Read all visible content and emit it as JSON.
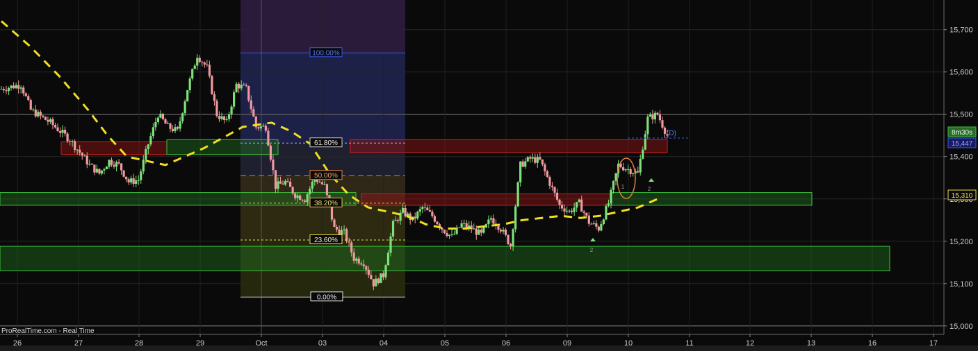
{
  "watermark": "ProRealTime.com - Real Time",
  "colors": {
    "background": "#0a0a0a",
    "up": "#7ee07a",
    "down": "#f09aa0",
    "ma": "#f0e020",
    "support_zone": "#1f6a1f",
    "resistance_zone": "#8a1a1a"
  },
  "chart_data": {
    "type": "candlestick",
    "ylim": [
      14980,
      15770
    ],
    "yticks": [
      15000,
      15100,
      15200,
      15300,
      15400,
      15500,
      15600,
      15700
    ],
    "ytick_labels": [
      "15,000",
      "15,100",
      "15,200",
      "15,300",
      "15,400",
      "15,500",
      "15,600",
      "15,700"
    ],
    "xtick_labels": [
      "26",
      "27",
      "28",
      "29",
      "Oct",
      "03",
      "04",
      "05",
      "06",
      "09",
      "10",
      "11",
      "12",
      "13",
      "16",
      "17"
    ],
    "price_labels": {
      "timer": "8m30s",
      "last": "15,447",
      "marker": "15,310"
    },
    "fib_labels": [
      "100.00%",
      "61.80%",
      "50.00%",
      "38.20%",
      "23.60%",
      "0.00%"
    ],
    "fib_levels": [
      {
        "label": "100.00%",
        "price": 15645
      },
      {
        "label": "61.80%",
        "price": 15432
      },
      {
        "label": "50.00%",
        "price": 15355
      },
      {
        "label": "38.20%",
        "price": 15290
      },
      {
        "label": "23.60%",
        "price": 15203
      },
      {
        "label": "0.00%",
        "price": 15068
      }
    ],
    "annotations": [
      "2",
      "2",
      "1",
      "(D)"
    ],
    "close_path": [
      [
        0,
        15560
      ],
      [
        2,
        15570
      ],
      [
        3,
        15510
      ],
      [
        5,
        15480
      ],
      [
        7,
        15440
      ],
      [
        9,
        15380
      ],
      [
        10,
        15360
      ],
      [
        11,
        15390
      ],
      [
        12,
        15380
      ],
      [
        13,
        15340
      ],
      [
        14,
        15345
      ],
      [
        15,
        15430
      ],
      [
        16,
        15500
      ],
      [
        17,
        15470
      ],
      [
        18,
        15460
      ],
      [
        19,
        15560
      ],
      [
        20,
        15640
      ],
      [
        21,
        15610
      ],
      [
        22,
        15500
      ],
      [
        23,
        15480
      ],
      [
        24,
        15570
      ],
      [
        25,
        15560
      ],
      [
        26,
        15470
      ],
      [
        27,
        15470
      ],
      [
        28,
        15330
      ],
      [
        29,
        15340
      ],
      [
        30,
        15310
      ],
      [
        31,
        15300
      ],
      [
        32,
        15350
      ],
      [
        33,
        15330
      ],
      [
        34,
        15230
      ],
      [
        35,
        15220
      ],
      [
        36,
        15160
      ],
      [
        37,
        15150
      ],
      [
        38,
        15100
      ],
      [
        39,
        15120
      ],
      [
        40,
        15240
      ],
      [
        41,
        15270
      ],
      [
        42,
        15250
      ],
      [
        43,
        15280
      ],
      [
        44,
        15260
      ],
      [
        45,
        15230
      ],
      [
        46,
        15210
      ],
      [
        47,
        15240
      ],
      [
        48,
        15230
      ],
      [
        49,
        15215
      ],
      [
        50,
        15255
      ],
      [
        51,
        15230
      ],
      [
        52,
        15190
      ],
      [
        53,
        15380
      ],
      [
        54,
        15395
      ],
      [
        55,
        15390
      ],
      [
        57,
        15285
      ],
      [
        58,
        15270
      ],
      [
        59,
        15290
      ],
      [
        60,
        15245
      ],
      [
        61,
        15230
      ],
      [
        62,
        15290
      ],
      [
        63,
        15380
      ],
      [
        64,
        15370
      ],
      [
        65,
        15360
      ],
      [
        66,
        15490
      ],
      [
        67,
        15500
      ],
      [
        68,
        15450
      ]
    ],
    "ma_path": [
      [
        0,
        15720
      ],
      [
        3,
        15660
      ],
      [
        6,
        15590
      ],
      [
        9,
        15510
      ],
      [
        11,
        15450
      ],
      [
        13,
        15400
      ],
      [
        15,
        15390
      ],
      [
        17,
        15380
      ],
      [
        19,
        15400
      ],
      [
        21,
        15420
      ],
      [
        23,
        15445
      ],
      [
        25,
        15470
      ],
      [
        28,
        15480
      ],
      [
        30,
        15460
      ],
      [
        32,
        15430
      ],
      [
        34,
        15360
      ],
      [
        36,
        15310
      ],
      [
        38,
        15280
      ],
      [
        40,
        15270
      ],
      [
        42,
        15260
      ],
      [
        44,
        15240
      ],
      [
        46,
        15230
      ],
      [
        48,
        15230
      ],
      [
        50,
        15235
      ],
      [
        52,
        15240
      ],
      [
        54,
        15250
      ],
      [
        56,
        15255
      ],
      [
        58,
        15260
      ],
      [
        60,
        15255
      ],
      [
        62,
        15260
      ],
      [
        64,
        15270
      ],
      [
        66,
        15280
      ],
      [
        68,
        15300
      ]
    ],
    "zones": [
      {
        "type": "resistance",
        "x0": 5.5,
        "x1": 15,
        "top": 15435,
        "bottom": 15405
      },
      {
        "type": "resistance",
        "x0": 31.5,
        "x1": 60,
        "top": 15440,
        "bottom": 15410
      },
      {
        "type": "resistance",
        "x0": 32.5,
        "x1": 55,
        "top": 15312,
        "bottom": 15285
      },
      {
        "type": "support",
        "x0": 15,
        "x1": 25,
        "top": 15440,
        "bottom": 15405
      },
      {
        "type": "support",
        "x0": 0,
        "x1": 32,
        "top": 15315,
        "bottom": 15285
      },
      {
        "type": "support",
        "x0": 55,
        "x1": 73,
        "top": 15315,
        "bottom": 15285
      },
      {
        "type": "support",
        "x0": 0,
        "x1": 80,
        "top": 15188,
        "bottom": 15130
      }
    ]
  }
}
